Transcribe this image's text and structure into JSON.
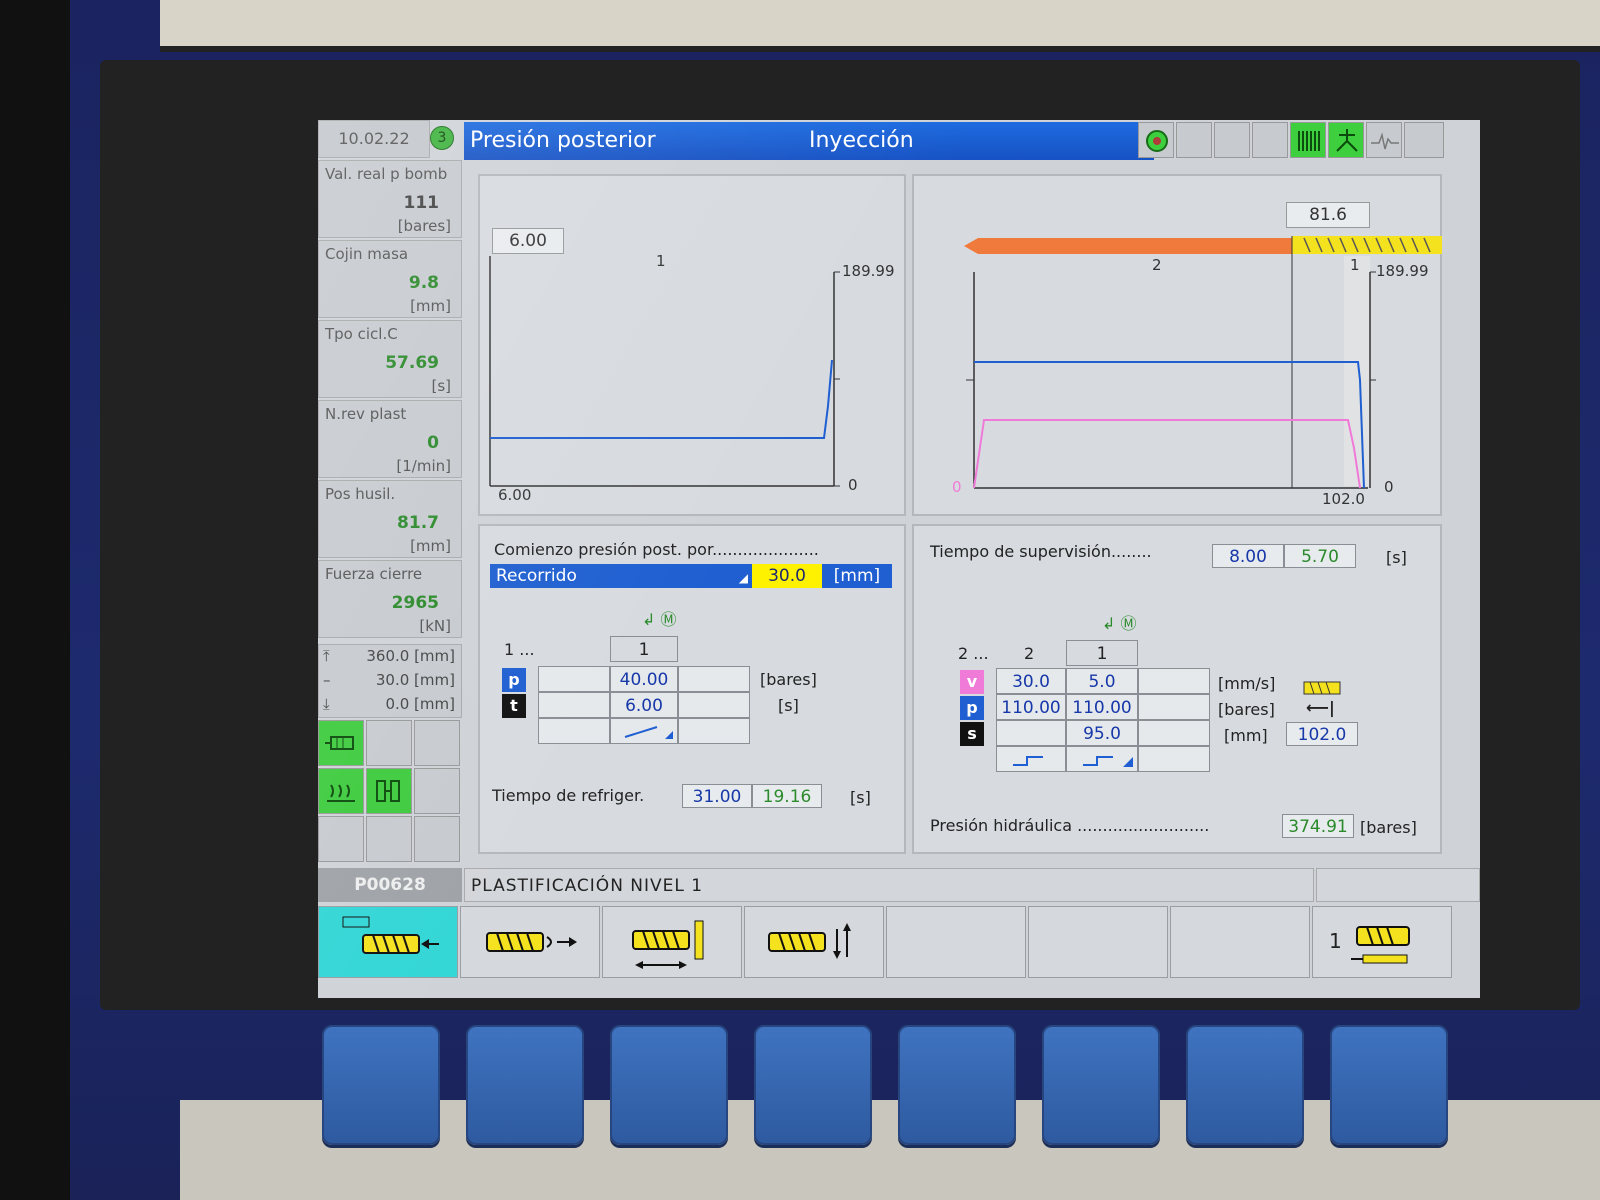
{
  "header": {
    "date": "10.02.22",
    "circle_number": "3",
    "title_left": "Presión posterior",
    "title_right": "Inyección"
  },
  "left_panel": [
    {
      "label": "Val. real p bomb",
      "value": "111",
      "unit": "[bares]"
    },
    {
      "label": "Cojin masa",
      "value": "9.8",
      "unit": "[mm]"
    },
    {
      "label": "Tpo cicl.C",
      "value": "57.69",
      "unit": "[s]"
    },
    {
      "label": "N.rev plast",
      "value": "0",
      "unit": "[1/min]"
    },
    {
      "label": "Pos husil.",
      "value": "81.7",
      "unit": "[mm]"
    },
    {
      "label": "Fuerza cierre",
      "value": "2965",
      "unit": "[kN]"
    }
  ],
  "positions": {
    "top": "360.0 [mm]",
    "mid": "30.0 [mm]",
    "bottom": "0.0 [mm]"
  },
  "graph_left": {
    "box_value": "6.00",
    "label_1": "1",
    "y_max": "189.99",
    "y_min": "0",
    "x_label": "6.00"
  },
  "graph_right": {
    "box_value": "81.6",
    "label_2": "2",
    "label_1": "1",
    "y_max": "189.99",
    "y_left_min": "0",
    "y_right_min": "0",
    "x_label": "102.0"
  },
  "holding": {
    "start_label": "Comienzo presión post. por",
    "mode": "Recorrido",
    "mode_value": "30.0",
    "mode_unit": "[mm]",
    "stage_prefix": "1 ...",
    "stage_header": "1",
    "p_value": "40.00",
    "t_value": "6.00",
    "p_unit": "[bares]",
    "t_unit": "[s]",
    "cool_label": "Tiempo de refriger.",
    "cool_set": "31.00",
    "cool_act": "19.16",
    "cool_unit": "[s]"
  },
  "injection": {
    "sup_label": "Tiempo de supervisión",
    "sup_set": "8.00",
    "sup_act": "5.70",
    "sup_unit": "[s]",
    "stage_prefix": "2 ...",
    "col2": "2",
    "col1": "1",
    "v2": "30.0",
    "v1": "5.0",
    "p2": "110.00",
    "p1": "110.00",
    "s1": "95.0",
    "v_unit": "[mm/s]",
    "p_unit": "[bares]",
    "s_unit": "[mm]",
    "switch_value": "102.0",
    "hyd_label": "Presión hidráulica",
    "hyd_value": "374.91",
    "hyd_unit": "[bares]"
  },
  "badges": {
    "p": "p",
    "t": "t",
    "v": "v",
    "s": "s"
  },
  "bottom": {
    "code": "P00628",
    "title": "PLASTIFICACIÓN NIVEL 1",
    "softkey_last_num": "1"
  },
  "colors": {
    "title_blue": "#1d6be0",
    "actual_green": "#2b8a2b",
    "set_blue": "#1638a8",
    "curve_blue": "#1f5fd1",
    "curve_pink": "#f07ad8",
    "active_softkey": "#33d6d6"
  }
}
